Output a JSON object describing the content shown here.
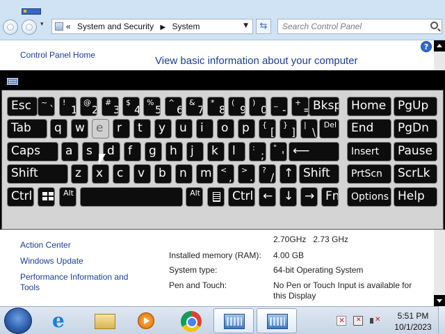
{
  "address_bar": {
    "path": [
      "System and Security",
      "System"
    ],
    "prefix": "«"
  },
  "search": {
    "placeholder": "Search Control Panel"
  },
  "sidebar": {
    "home_link": "Control Panel Home",
    "see_also": [
      "Action Center",
      "Windows Update",
      "Performance Information and Tools"
    ]
  },
  "main": {
    "title": "View basic information about your computer",
    "processor_speed": "2.70GHz   2.73 GHz",
    "installed_memory_label": "Installed memory (RAM):",
    "installed_memory_value": "4.00 GB",
    "system_type_label": "System type:",
    "system_type_value": "64-bit Operating System",
    "pen_touch_label": "Pen and Touch:",
    "pen_touch_value": "No Pen or Touch Input is available for this Display"
  },
  "keyboard": {
    "row1": [
      {
        "label": "Esc"
      },
      {
        "top": "~",
        "main": "`"
      },
      {
        "top": "!",
        "main": "1"
      },
      {
        "top": "@",
        "main": "2"
      },
      {
        "top": "#",
        "main": "3"
      },
      {
        "top": "$",
        "main": "4"
      },
      {
        "top": "%",
        "main": "5"
      },
      {
        "top": "^",
        "main": "6"
      },
      {
        "top": "&",
        "main": "7"
      },
      {
        "top": "*",
        "main": "8"
      },
      {
        "top": "(",
        "main": "9"
      },
      {
        "top": ")",
        "main": "0"
      },
      {
        "top": "_",
        "main": "-"
      },
      {
        "top": "+",
        "main": "="
      },
      {
        "label": "Bksp"
      },
      {
        "label": "Home"
      },
      {
        "label": "PgUp"
      }
    ],
    "row2": [
      {
        "label": "Tab"
      },
      {
        "label": "q"
      },
      {
        "label": "w"
      },
      {
        "label": "e",
        "hover": true
      },
      {
        "label": "r"
      },
      {
        "label": "t"
      },
      {
        "label": "y"
      },
      {
        "label": "u"
      },
      {
        "label": "i"
      },
      {
        "label": "o"
      },
      {
        "label": "p"
      },
      {
        "top": "{",
        "main": "["
      },
      {
        "top": "}",
        "main": "]"
      },
      {
        "top": "|",
        "main": "\\"
      },
      {
        "label": "Del"
      },
      {
        "label": "End"
      },
      {
        "label": "PgDn"
      }
    ],
    "row3": [
      {
        "label": "Caps"
      },
      {
        "label": "a"
      },
      {
        "label": "s"
      },
      {
        "label": "d"
      },
      {
        "label": "f"
      },
      {
        "label": "g"
      },
      {
        "label": "h"
      },
      {
        "label": "j"
      },
      {
        "label": "k"
      },
      {
        "label": "l"
      },
      {
        "top": ":",
        "main": ";"
      },
      {
        "top": "\"",
        "main": "'"
      },
      {
        "label": "⟵"
      },
      {
        "label": "Insert"
      },
      {
        "label": "Pause"
      }
    ],
    "row4": [
      {
        "label": "Shift"
      },
      {
        "label": "z"
      },
      {
        "label": "x"
      },
      {
        "label": "c"
      },
      {
        "label": "v"
      },
      {
        "label": "b"
      },
      {
        "label": "n"
      },
      {
        "label": "m"
      },
      {
        "top": "<",
        "main": ","
      },
      {
        "top": ">",
        "main": "."
      },
      {
        "top": "?",
        "main": "/"
      },
      {
        "label": "↑"
      },
      {
        "label": "Shift"
      },
      {
        "label": "PrtScn"
      },
      {
        "label": "ScrLk"
      }
    ],
    "row5": [
      {
        "label": "Ctrl"
      },
      {
        "label": "",
        "icon": "windows-logo-icon"
      },
      {
        "label": "Alt"
      },
      {
        "label": ""
      },
      {
        "label": "Alt"
      },
      {
        "label": "",
        "icon": "menu-key-icon"
      },
      {
        "label": "Ctrl"
      },
      {
        "label": "←"
      },
      {
        "label": "↓"
      },
      {
        "label": "→"
      },
      {
        "label": "Fn"
      },
      {
        "label": "Options"
      },
      {
        "label": "Help"
      }
    ]
  },
  "taskbar": {
    "apps": [
      "internet-explorer-icon",
      "windows-explorer-icon",
      "media-player-icon",
      "chrome-icon",
      "control-panel-icon",
      "on-screen-keyboard-icon"
    ],
    "clock_time": "5:51 PM",
    "clock_date": "10/1/2023"
  },
  "colors": {
    "chrome_bg": "#cfe3f5",
    "link_blue": "#1a3d8f",
    "key_bg": "#0d0d0d",
    "key_hover": "#cfcfcf"
  }
}
